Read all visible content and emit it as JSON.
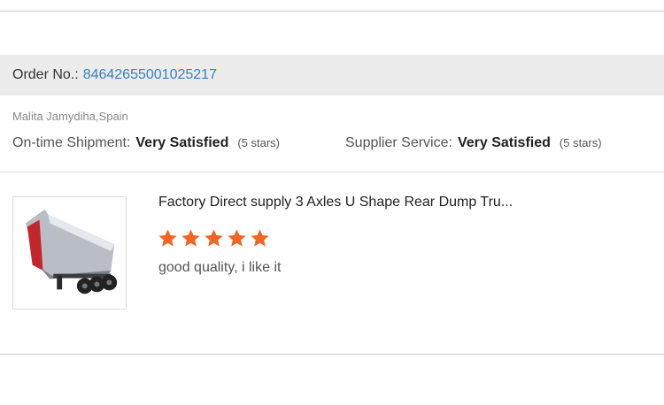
{
  "order": {
    "label": "Order No.:",
    "number": "84642655001025217"
  },
  "buyer": {
    "name_location": "Malita Jamydiha,Spain"
  },
  "ratings": [
    {
      "label": "On-time Shipment:",
      "value": "Very Satisfied",
      "stars_text": "(5 stars)"
    },
    {
      "label": "Supplier Service:",
      "value": "Very Satisfied",
      "stars_text": "(5 stars)"
    }
  ],
  "review": {
    "product_title": "Factory Direct supply 3 Axles U Shape Rear Dump Tru...",
    "rating": 5,
    "max_rating": 5,
    "text": "good quality, i like it",
    "star_color": "#f26522"
  },
  "colors": {
    "order_number": "#3a7fc3",
    "order_bar_bg": "#ececec"
  }
}
